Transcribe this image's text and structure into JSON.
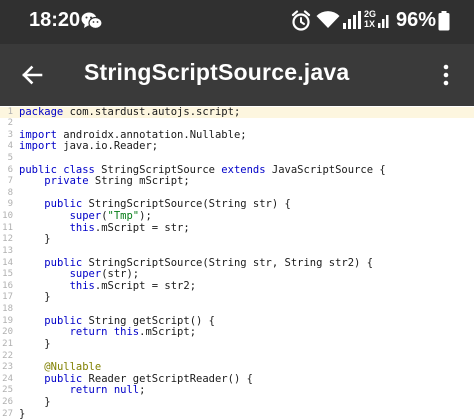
{
  "status_bar": {
    "time": "18:20",
    "wechat_icon": "wechat-icon",
    "alarm_icon": "alarm-icon",
    "wifi_icon": "wifi-icon",
    "signal_icon": "signal-icon",
    "network_label_top": "2G",
    "network_label_bottom": "1X",
    "battery_percent": "96%",
    "battery_icon": "battery-icon"
  },
  "toolbar": {
    "back_icon": "arrow-back-icon",
    "title": "StringScriptSource.java",
    "more_icon": "more-vert-icon"
  },
  "editor": {
    "colors": {
      "keyword": "#0000c8",
      "string": "#067d17",
      "annotation": "#808000",
      "current_line": "#fdf6df",
      "line_number": "#b0b0b0"
    },
    "lines": [
      {
        "n": "1",
        "current": true,
        "tokens": [
          [
            "k",
            "package"
          ],
          [
            "p",
            " com.stardust.autojs.script;"
          ]
        ]
      },
      {
        "n": "2",
        "tokens": []
      },
      {
        "n": "3",
        "tokens": [
          [
            "k",
            "import"
          ],
          [
            "p",
            " androidx.annotation.Nullable;"
          ]
        ]
      },
      {
        "n": "4",
        "tokens": [
          [
            "k",
            "import"
          ],
          [
            "p",
            " java.io.Reader;"
          ]
        ]
      },
      {
        "n": "5",
        "tokens": []
      },
      {
        "n": "6",
        "tokens": [
          [
            "k",
            "public class"
          ],
          [
            "p",
            " StringScriptSource "
          ],
          [
            "k",
            "extends"
          ],
          [
            "p",
            " JavaScriptSource {"
          ]
        ]
      },
      {
        "n": "7",
        "tokens": [
          [
            "p",
            "    "
          ],
          [
            "k",
            "private"
          ],
          [
            "p",
            " String mScript;"
          ]
        ]
      },
      {
        "n": "8",
        "tokens": []
      },
      {
        "n": "9",
        "tokens": [
          [
            "p",
            "    "
          ],
          [
            "k",
            "public"
          ],
          [
            "p",
            " StringScriptSource(String str) {"
          ]
        ]
      },
      {
        "n": "10",
        "tokens": [
          [
            "p",
            "        "
          ],
          [
            "k",
            "super"
          ],
          [
            "p",
            "("
          ],
          [
            "s",
            "\"Tmp\""
          ],
          [
            "p",
            ");"
          ]
        ]
      },
      {
        "n": "11",
        "tokens": [
          [
            "p",
            "        "
          ],
          [
            "k",
            "this"
          ],
          [
            "p",
            ".mScript = str;"
          ]
        ]
      },
      {
        "n": "12",
        "tokens": [
          [
            "p",
            "    }"
          ]
        ]
      },
      {
        "n": "13",
        "tokens": []
      },
      {
        "n": "14",
        "tokens": [
          [
            "p",
            "    "
          ],
          [
            "k",
            "public"
          ],
          [
            "p",
            " StringScriptSource(String str, String str2) {"
          ]
        ]
      },
      {
        "n": "15",
        "tokens": [
          [
            "p",
            "        "
          ],
          [
            "k",
            "super"
          ],
          [
            "p",
            "(str);"
          ]
        ]
      },
      {
        "n": "16",
        "tokens": [
          [
            "p",
            "        "
          ],
          [
            "k",
            "this"
          ],
          [
            "p",
            ".mScript = str2;"
          ]
        ]
      },
      {
        "n": "17",
        "tokens": [
          [
            "p",
            "    }"
          ]
        ]
      },
      {
        "n": "18",
        "tokens": []
      },
      {
        "n": "19",
        "tokens": [
          [
            "p",
            "    "
          ],
          [
            "k",
            "public"
          ],
          [
            "p",
            " String getScript() {"
          ]
        ]
      },
      {
        "n": "20",
        "tokens": [
          [
            "p",
            "        "
          ],
          [
            "k",
            "return this"
          ],
          [
            "p",
            ".mScript;"
          ]
        ]
      },
      {
        "n": "21",
        "tokens": [
          [
            "p",
            "    }"
          ]
        ]
      },
      {
        "n": "22",
        "tokens": []
      },
      {
        "n": "23",
        "tokens": [
          [
            "p",
            "    "
          ],
          [
            "a",
            "@Nullable"
          ]
        ]
      },
      {
        "n": "24",
        "tokens": [
          [
            "p",
            "    "
          ],
          [
            "k",
            "public"
          ],
          [
            "p",
            " Reader getScriptReader() {"
          ]
        ]
      },
      {
        "n": "25",
        "tokens": [
          [
            "p",
            "        "
          ],
          [
            "k",
            "return null"
          ],
          [
            "p",
            ";"
          ]
        ]
      },
      {
        "n": "26",
        "tokens": [
          [
            "p",
            "    }"
          ]
        ]
      },
      {
        "n": "27",
        "tokens": [
          [
            "p",
            "}"
          ]
        ]
      }
    ]
  }
}
